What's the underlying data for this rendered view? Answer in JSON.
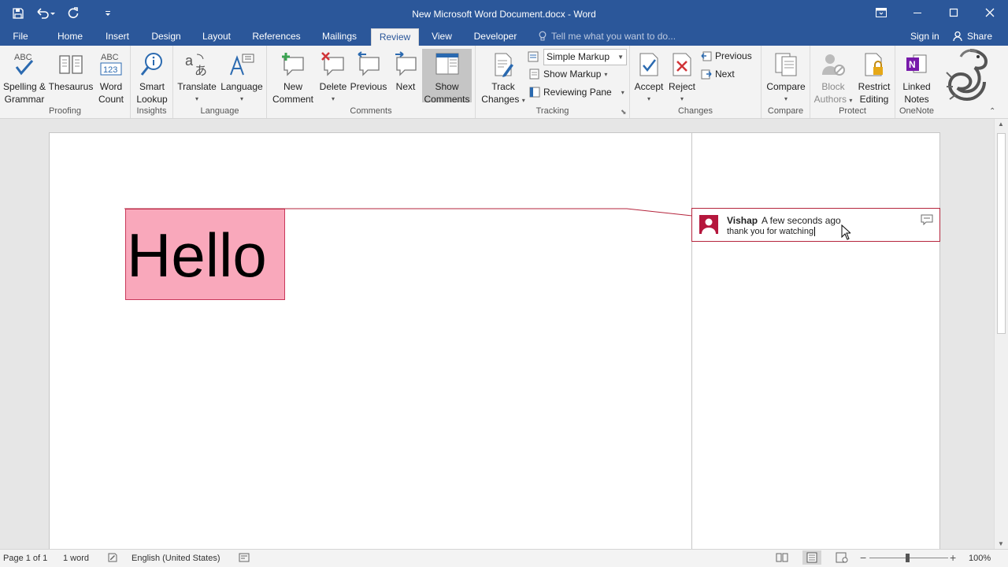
{
  "window": {
    "title": "New Microsoft Word Document.docx - Word",
    "controls": [
      "ribbon-display-options",
      "minimize",
      "maximize",
      "close"
    ]
  },
  "quick_access": [
    "save-icon",
    "undo-icon",
    "redo-icon",
    "customize-qat-icon"
  ],
  "tabs": [
    {
      "label": "File"
    },
    {
      "label": "Home"
    },
    {
      "label": "Insert"
    },
    {
      "label": "Design"
    },
    {
      "label": "Layout"
    },
    {
      "label": "References"
    },
    {
      "label": "Mailings"
    },
    {
      "label": "Review"
    },
    {
      "label": "View"
    },
    {
      "label": "Developer"
    }
  ],
  "active_tab": "Review",
  "tell_me": {
    "placeholder": "Tell me what you want to do..."
  },
  "account": {
    "sign_in": "Sign in",
    "share": "Share"
  },
  "ribbon": {
    "proofing": {
      "label": "Proofing",
      "spelling_1": "Spelling &",
      "spelling_2": "Grammar",
      "spelling_icon_text": "ABC",
      "thesaurus": "Thesaurus",
      "word_count_1": "Word",
      "word_count_2": "Count",
      "word_count_icon_1": "ABC",
      "word_count_icon_2": "123"
    },
    "insights": {
      "label": "Insights",
      "smart_lookup_1": "Smart",
      "smart_lookup_2": "Lookup"
    },
    "language": {
      "label": "Language",
      "translate": "Translate",
      "language": "Language"
    },
    "comments": {
      "label": "Comments",
      "new_1": "New",
      "new_2": "Comment",
      "delete": "Delete",
      "previous": "Previous",
      "next": "Next",
      "show_1": "Show",
      "show_2": "Comments"
    },
    "tracking": {
      "label": "Tracking",
      "track_1": "Track",
      "track_2": "Changes",
      "display_for_review": "Simple Markup",
      "show_markup": "Show Markup",
      "reviewing_pane": "Reviewing Pane"
    },
    "changes": {
      "label": "Changes",
      "accept": "Accept",
      "reject": "Reject",
      "previous": "Previous",
      "next": "Next"
    },
    "compare": {
      "label": "Compare",
      "compare": "Compare"
    },
    "protect": {
      "label": "Protect",
      "block_1": "Block",
      "block_2": "Authors",
      "restrict_1": "Restrict",
      "restrict_2": "Editing"
    },
    "onenote": {
      "label": "OneNote",
      "linked_1": "Linked",
      "linked_2": "Notes"
    }
  },
  "document": {
    "text": "Hello",
    "comment": {
      "author": "Vishap",
      "time": "A few seconds ago",
      "text": "thank you for watching"
    }
  },
  "status": {
    "page": "Page 1 of 1",
    "words": "1 word",
    "language": "English (United States)",
    "zoom": "100%",
    "zoom_level": 100
  },
  "colors": {
    "title_bar": "#2b579a",
    "comment_accent": "#b5253d",
    "highlight": "#f9a8bb"
  }
}
